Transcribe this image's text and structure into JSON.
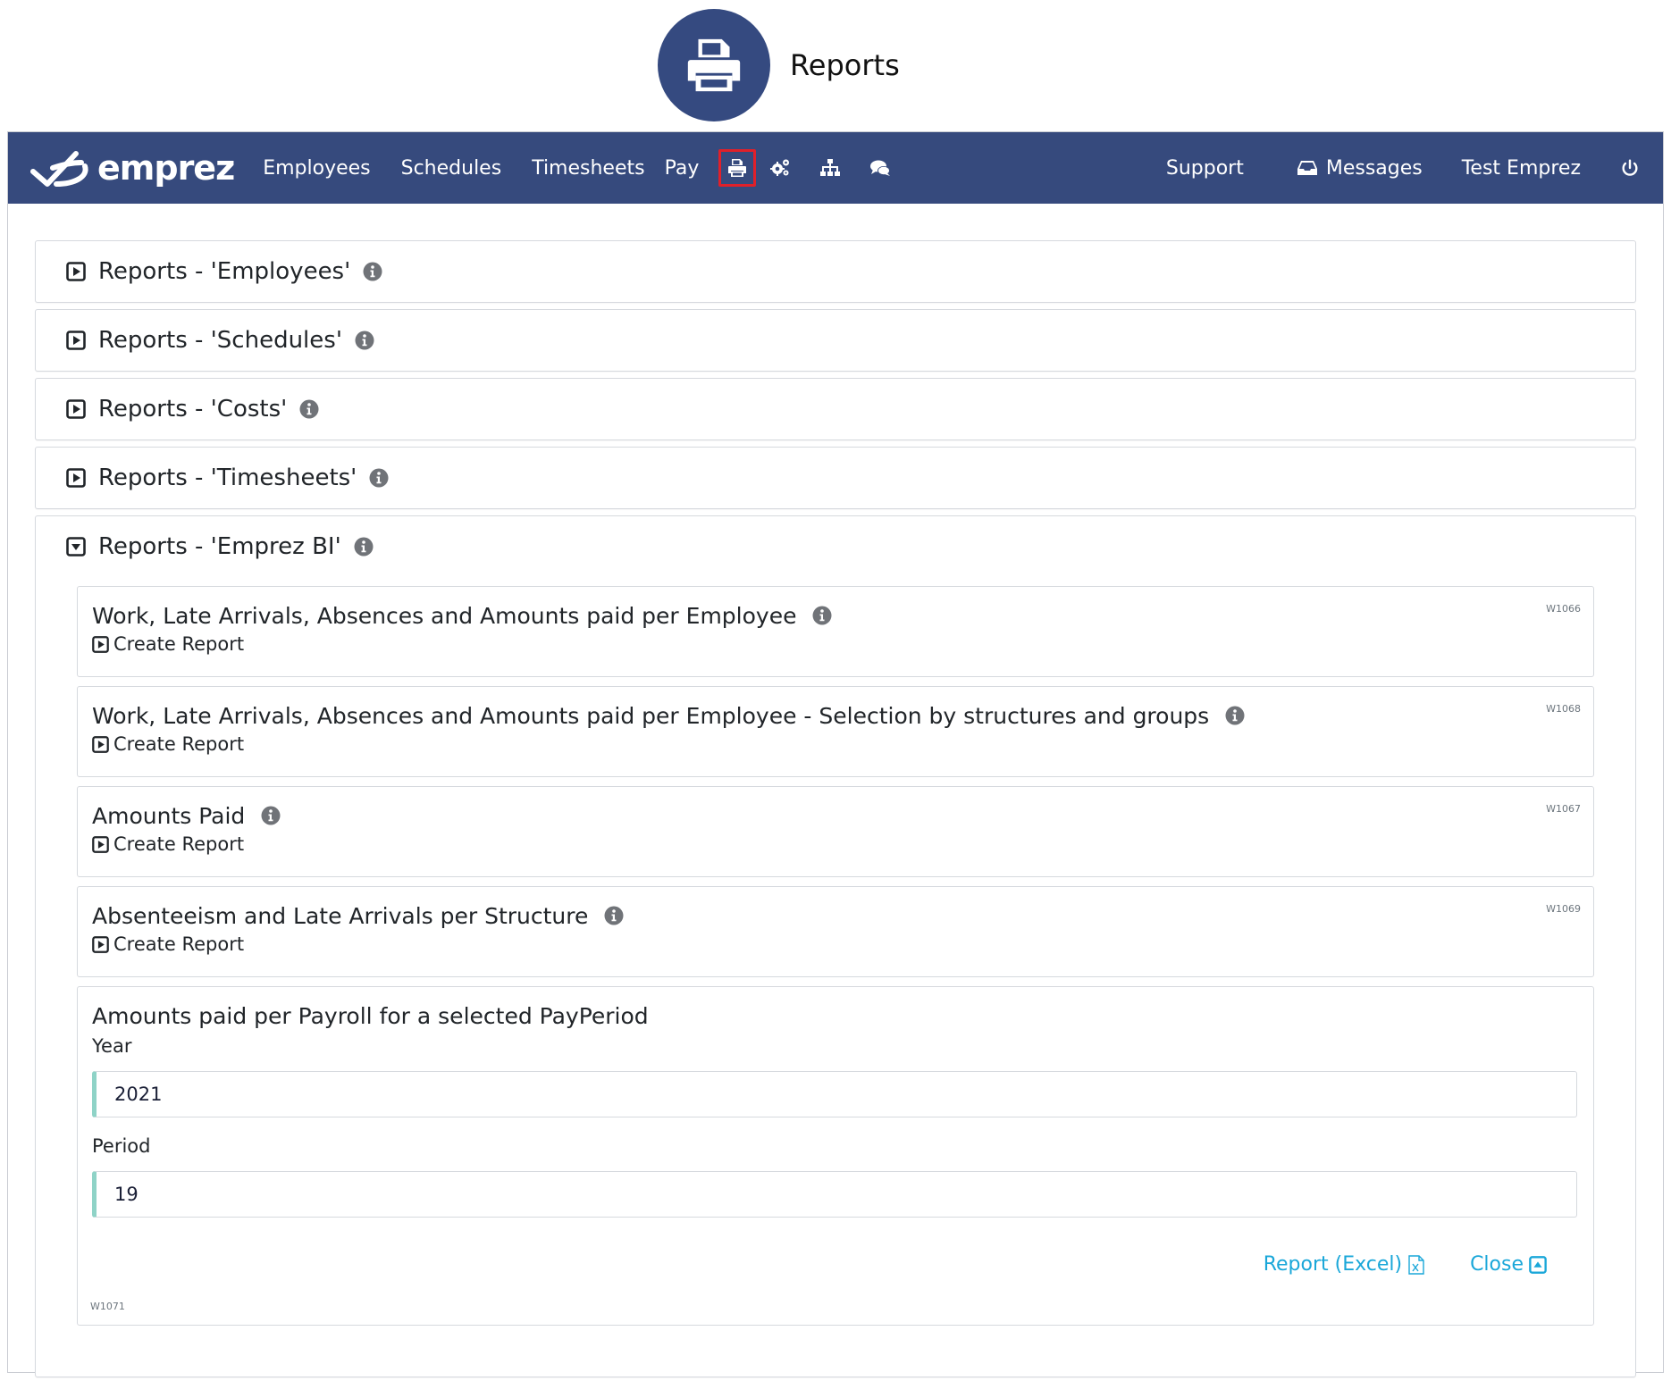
{
  "doc_header": {
    "title": "Reports",
    "icon": "printer-icon"
  },
  "navbar": {
    "brand": "emprez",
    "links": [
      "Employees",
      "Schedules",
      "Timesheets",
      "Pay"
    ],
    "icons": [
      "printer-icon",
      "gears-icon",
      "sitemap-icon",
      "comments-icon"
    ],
    "support": "Support",
    "messages": "Messages",
    "user": "Test Emprez",
    "bg_color": "#364a7d",
    "highlight_color": "#e0202a"
  },
  "panels": [
    {
      "title": "Reports - 'Employees'",
      "state": "collapsed"
    },
    {
      "title": "Reports - 'Schedules'",
      "state": "collapsed"
    },
    {
      "title": "Reports - 'Costs'",
      "state": "collapsed"
    },
    {
      "title": "Reports - 'Timesheets'",
      "state": "collapsed"
    },
    {
      "title": "Reports - 'Emprez BI'",
      "state": "expanded"
    }
  ],
  "reports": [
    {
      "title": "Work, Late Arrivals, Absences and Amounts paid per Employee",
      "action": "Create Report",
      "code": "W1066"
    },
    {
      "title": "Work, Late Arrivals, Absences and Amounts paid per Employee - Selection by structures and groups",
      "action": "Create Report",
      "code": "W1068"
    },
    {
      "title": "Amounts Paid",
      "action": "Create Report",
      "code": "W1067"
    },
    {
      "title": "Absenteeism and Late Arrivals per Structure",
      "action": "Create Report",
      "code": "W1069"
    }
  ],
  "form": {
    "title": "Amounts paid per Payroll for a selected PayPeriod",
    "year_label": "Year",
    "year_value": "2021",
    "period_label": "Period",
    "period_value": "19",
    "excel_label": "Report (Excel)",
    "close_label": "Close",
    "code": "W1071",
    "accent_color": "#1aa7d9"
  }
}
